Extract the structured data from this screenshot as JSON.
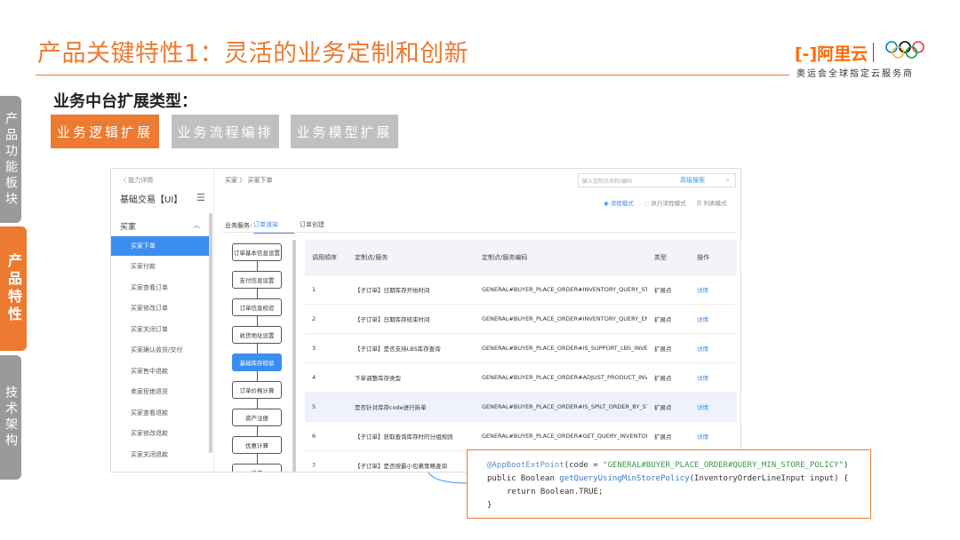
{
  "slide": {
    "title": "产品关键特性1：灵活的业务定制和创新",
    "brand_logo": "[-]阿里云",
    "brand_subtitle": "奥运会全球指定云服务商",
    "subheading": "业务中台扩展类型：",
    "left_tabs": [
      "产品功能板块",
      "产品特性",
      "技术架构"
    ],
    "type_buttons": [
      "业务逻辑扩展",
      "业务流程编排",
      "业务模型扩展"
    ],
    "accent_color": "#ec7a30"
  },
  "app": {
    "back_link": "〈 能力详情",
    "app_name": "基础交易【UI】",
    "group_label": "买家",
    "sidebar_items": [
      "买家下单",
      "买家付款",
      "买家查看订单",
      "买家修改订单",
      "买家关闭订单",
      "买家确认收货/交付",
      "买家售中退款",
      "卖家拒绝退货",
      "买家查看退款",
      "买家修改退款",
      "买家关闭退款"
    ],
    "active_sidebar_index": 0,
    "breadcrumb": "买家 〉 买家下单",
    "search_placeholder": "输入定制点名称/编码",
    "advanced_search": "高级搜索",
    "modes": [
      "◉ 流程模式",
      "◌ 执行流程模式",
      "☰ 列表模式"
    ],
    "service_label": "业务服务:",
    "tabs": [
      "订单渲染",
      "订单创建"
    ],
    "flow_nodes": [
      "订单基本信息设置",
      "支付信息设置",
      "订单信息校验",
      "收货地址设置",
      "基础库存校验",
      "订单价格计算",
      "资产注册",
      "优惠计算",
      "拆单"
    ],
    "active_flow_index": 4,
    "table": {
      "headers": [
        "调用顺序",
        "定制点/服务",
        "定制点/服务编码",
        "类型",
        "操作"
      ],
      "rows": [
        {
          "order": "1",
          "name": "【子订单】日期库存开始时间",
          "code": "GENERAL#BUYER_PLACE_ORDER#INVENTORY_QUERY_START_DATE",
          "type": "扩展点",
          "op": "详情"
        },
        {
          "order": "2",
          "name": "【子订单】日期库存结束时间",
          "code": "GENERAL#BUYER_PLACE_ORDER#INVENTORY_QUERY_END_DATE",
          "type": "扩展点",
          "op": "详情"
        },
        {
          "order": "3",
          "name": "【子订单】是否支持LBS库存查询",
          "code": "GENERAL#BUYER_PLACE_ORDER#IS_SUPPORT_LBS_INVENTORY_QUERY",
          "type": "扩展点",
          "op": "详情"
        },
        {
          "order": "4",
          "name": "下单调整库存类型",
          "code": "GENERAL#BUYER_PLACE_ORDER#ADJUST_PRODUCT_INVENTORY_TYPE",
          "type": "扩展点",
          "op": "详情"
        },
        {
          "order": "5",
          "name": "是否针对库存code进行拆单",
          "code": "GENERAL#BUYER_PLACE_ORDER#IS_SPILT_ORDER_BY_STORE_CODE",
          "type": "扩展点",
          "op": "详情"
        },
        {
          "order": "6",
          "name": "【子订单】获取查询库存时的分组规则",
          "code": "GENERAL#BUYER_PLACE_ORDER#GET_QUERY_INVENTORY_GROUP",
          "type": "扩展点",
          "op": "详情"
        },
        {
          "order": "7",
          "name": "【子订单】是否按最小包裹策略查询",
          "code": "",
          "type": "",
          "op": ""
        }
      ],
      "highlight_row_index": 4
    }
  },
  "code": {
    "line1_annot": "@AppBootExtPoint",
    "line1_open": "(code = ",
    "line1_str": "\"GENERAL#BUYER_PLACE_ORDER#QUERY_MIN_STORE_POLICY\"",
    "line1_close": ")",
    "line2_kw": "public Boolean ",
    "line2_fn": "getQueryUsingMinStorePolicy",
    "line2_rest": "(InventoryOrderLineInput input) {",
    "line3": "return Boolean.TRUE;",
    "line4": "}"
  }
}
